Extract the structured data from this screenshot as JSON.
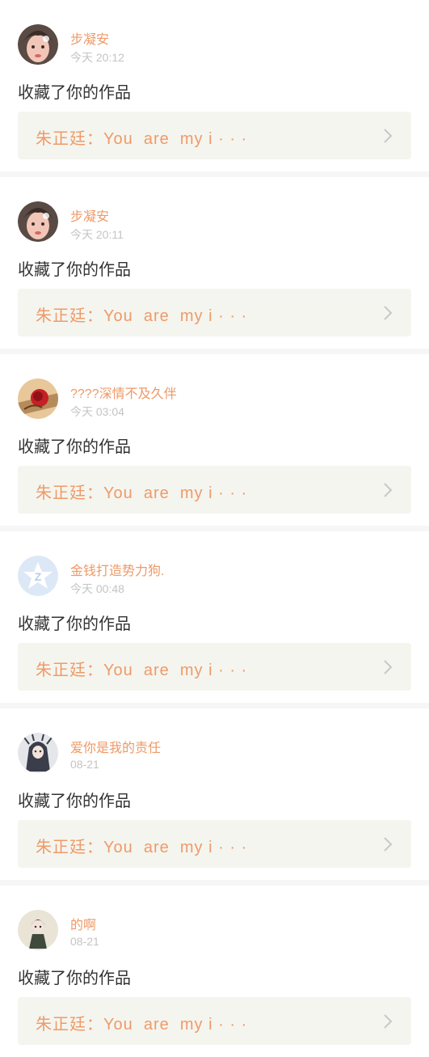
{
  "items": [
    {
      "user": "步凝安",
      "time": "今天 20:12",
      "action": "收藏了你的作品",
      "quote": "朱正廷：You  are  my i · · ·",
      "avatar": "portrait-avatar"
    },
    {
      "user": "步凝安",
      "time": "今天 20:11",
      "action": "收藏了你的作品",
      "quote": "朱正廷：You  are  my i · · ·",
      "avatar": "portrait-avatar"
    },
    {
      "user": "????深情不及久伴",
      "time": "今天 03:04",
      "action": "收藏了你的作品",
      "quote": "朱正廷：You  are  my i · · ·",
      "avatar": "rose-avatar"
    },
    {
      "user": "金钱打造势力狗.",
      "time": "今天 00:48",
      "action": "收藏了你的作品",
      "quote": "朱正廷：You  are  my i · · ·",
      "avatar": "default-star-avatar"
    },
    {
      "user": "爱你是我的责任",
      "time": "08-21",
      "action": "收藏了你的作品",
      "quote": "朱正廷：You  are  my i · · ·",
      "avatar": "anime-dark-avatar"
    },
    {
      "user": "的啊",
      "time": "08-21",
      "action": "收藏了你的作品",
      "quote": "朱正廷：You  are  my i · · ·",
      "avatar": "anime-girl-avatar"
    }
  ],
  "colors": {
    "username": "#ee9966",
    "time": "#c4c4c4",
    "action": "#333333",
    "quote_text": "#ef9a68",
    "quote_bg": "#f4f5ef",
    "separator": "#f6f6f6",
    "top_indicator": "#f07aa5"
  }
}
